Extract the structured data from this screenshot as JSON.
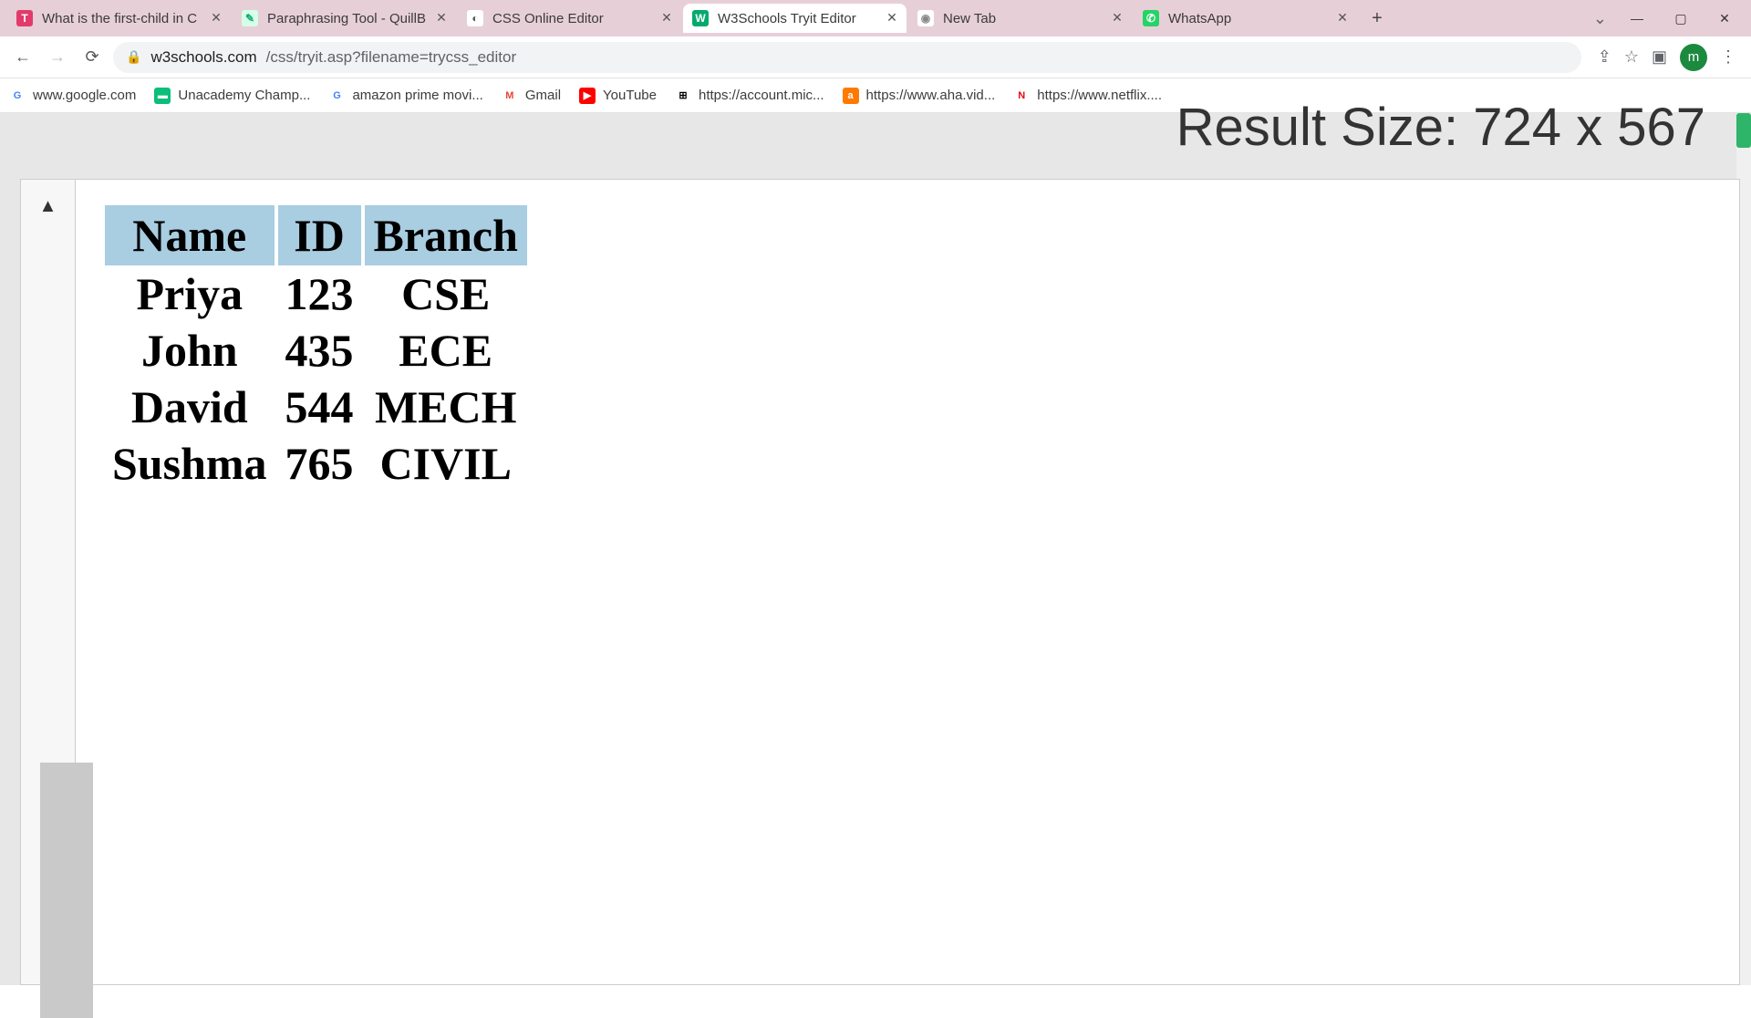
{
  "tabs": [
    {
      "title": "What is the first-child in C",
      "favicon_bg": "#e23b6b",
      "favicon_fg": "#fff",
      "favicon_text": "T",
      "active": false
    },
    {
      "title": "Paraphrasing Tool - QuillB",
      "favicon_bg": "#d7ffe8",
      "favicon_fg": "#1a7",
      "favicon_text": "✎",
      "active": false
    },
    {
      "title": "CSS Online Editor",
      "favicon_bg": "#fff",
      "favicon_fg": "#556",
      "favicon_text": "◐",
      "active": false
    },
    {
      "title": "W3Schools Tryit Editor",
      "favicon_bg": "#04aa6d",
      "favicon_fg": "#fff",
      "favicon_text": "W",
      "active": true
    },
    {
      "title": "New Tab",
      "favicon_bg": "#fff",
      "favicon_fg": "#888",
      "favicon_text": "◉",
      "active": false
    },
    {
      "title": "WhatsApp",
      "favicon_bg": "#25d366",
      "favicon_fg": "#fff",
      "favicon_text": "✆",
      "active": false
    }
  ],
  "url": {
    "host": "w3schools.com",
    "path": "/css/tryit.asp?filename=trycss_editor"
  },
  "avatar_letter": "m",
  "bookmarks": [
    {
      "label": "www.google.com",
      "icon_bg": "#fff",
      "icon_fg": "#4285f4",
      "icon_text": "G"
    },
    {
      "label": "Unacademy Champ...",
      "icon_bg": "#0bbe7a",
      "icon_fg": "#fff",
      "icon_text": "▬"
    },
    {
      "label": "amazon prime movi...",
      "icon_bg": "#fff",
      "icon_fg": "#4285f4",
      "icon_text": "G"
    },
    {
      "label": "Gmail",
      "icon_bg": "#fff",
      "icon_fg": "#ea4335",
      "icon_text": "M"
    },
    {
      "label": "YouTube",
      "icon_bg": "#ff0000",
      "icon_fg": "#fff",
      "icon_text": "▶"
    },
    {
      "label": "https://account.mic...",
      "icon_bg": "#fff",
      "icon_fg": "#000",
      "icon_text": "⊞"
    },
    {
      "label": "https://www.aha.vid...",
      "icon_bg": "#ff7a00",
      "icon_fg": "#fff",
      "icon_text": "a"
    },
    {
      "label": "https://www.netflix....",
      "icon_bg": "#fff",
      "icon_fg": "#e50914",
      "icon_text": "N"
    }
  ],
  "result_size_label": "Result Size: 724 x 567",
  "chart_data": {
    "type": "table",
    "headers": [
      "Name",
      "ID",
      "Branch"
    ],
    "rows": [
      [
        "Priya",
        "123",
        "CSE"
      ],
      [
        "John",
        "435",
        "ECE"
      ],
      [
        "David",
        "544",
        "MECH"
      ],
      [
        "Sushma",
        "765",
        "CIVIL"
      ]
    ]
  }
}
